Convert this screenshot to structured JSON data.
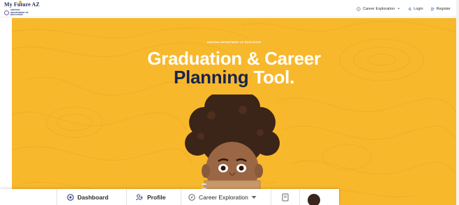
{
  "logo": {
    "title": "My Future AZ",
    "subtitle": "ARIZONA DEPARTMENT OF EDUCATION"
  },
  "nav": {
    "career_exploration": "Career Exploration",
    "login": "Login",
    "register": "Register"
  },
  "hero": {
    "kicker": "ARIZONA DEPARTMENT OF EDUCATION",
    "title_line1": "Graduation & Career",
    "title_accent": "Planning",
    "title_rest": "Tool."
  },
  "bottom_bar": {
    "dashboard": "Dashboard",
    "profile": "Profile",
    "career_exploration": "Career Exploration"
  },
  "colors": {
    "hero_bg": "#f8b82c",
    "accent_navy": "#16234f",
    "white": "#ffffff"
  }
}
